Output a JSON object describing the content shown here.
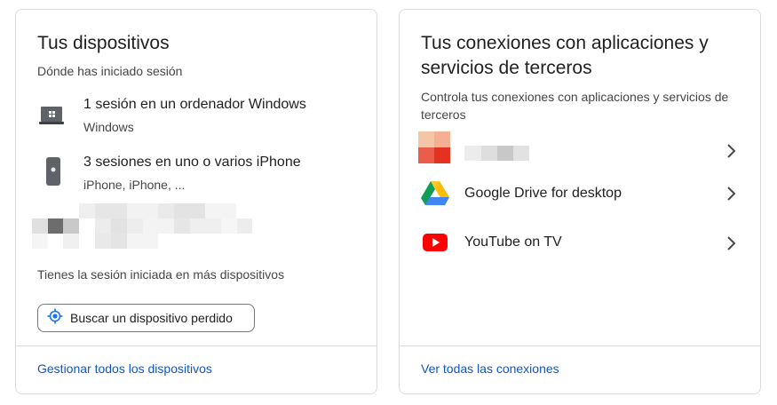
{
  "devices_card": {
    "title": "Tus dispositivos",
    "subtitle": "Dónde has iniciado sesión",
    "devices": [
      {
        "name": "1 sesión en un ordenador Windows",
        "detail": "Windows",
        "icon": "laptop-windows-icon"
      },
      {
        "name": "3 sesiones en uno o varios iPhone",
        "detail": "iPhone, iPhone, ...",
        "icon": "iphone-icon"
      }
    ],
    "more_devices_text": "Tienes la sesión iniciada en más dispositivos",
    "find_button_label": "Buscar un dispositivo perdido",
    "footer_link": "Gestionar todos los dispositivos"
  },
  "connections_card": {
    "title_line1": "Tus conexiones con aplicaciones y",
    "title_line2": "servicios de terceros",
    "subtitle_line1": "Controla tus conexiones con aplicaciones y servicios de",
    "subtitle_line2": "terceros",
    "apps": [
      {
        "name": "",
        "icon": "pixelated-app-icon"
      },
      {
        "name": "Google Drive for desktop",
        "icon": "google-drive-icon"
      },
      {
        "name": "YouTube on TV",
        "icon": "youtube-icon"
      }
    ],
    "footer_link": "Ver todas las conexiones"
  },
  "colors": {
    "link": "#0b57d0",
    "border": "#dadce0",
    "text_primary": "#1f1f1f",
    "text_secondary": "#444746",
    "accent_blue": "#1a73e8"
  }
}
